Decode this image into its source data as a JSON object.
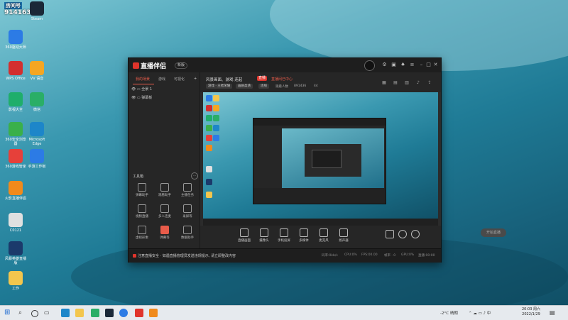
{
  "desktop": {
    "room_overlay": "房间号",
    "room_number": "914163",
    "icons": [
      {
        "label": "3:53",
        "color": "#2a6ad0"
      },
      {
        "label": "Steam",
        "color": "#1b2838"
      },
      {
        "label": "360驱动大师",
        "color": "#2c7be5"
      },
      {
        "label": "WPS Office",
        "color": "#d32f2f"
      },
      {
        "label": "VV 语音",
        "color": "#f5a623"
      },
      {
        "label": "影视大全",
        "color": "#1fae6b"
      },
      {
        "label": "微信",
        "color": "#2aae67"
      },
      {
        "label": "360安全浏览器",
        "color": "#3ab04a"
      },
      {
        "label": "Microsoft Edge",
        "color": "#1d86c9"
      },
      {
        "label": "360游戏管家",
        "color": "#e6403a"
      },
      {
        "label": "手游工作板",
        "color": "#2c7be5"
      },
      {
        "label": "火影直播伴侣",
        "color": "#f08a1c"
      },
      {
        "label": "C0121",
        "color": "#e0e0e0"
      },
      {
        "label": "风暴英雄直播版",
        "color": "#1b3a6b"
      },
      {
        "label": "工作",
        "color": "#f3c64d"
      }
    ]
  },
  "app": {
    "brand": "直播伴侣",
    "version": "新版",
    "left_tabs": [
      "我的场景",
      "游戏",
      "可视化"
    ],
    "scenes": [
      "全景 1",
      "弹幕板"
    ],
    "tools_title": "工具箱",
    "tools": [
      {
        "label": "弹幕助手",
        "red": false
      },
      {
        "label": "观看助手",
        "red": false
      },
      {
        "label": "主播任务",
        "red": false
      },
      {
        "label": "视频直播",
        "red": false
      },
      {
        "label": "多人连麦",
        "red": false
      },
      {
        "label": "录屏等",
        "red": false
      },
      {
        "label": "虚拟形象",
        "red": false
      },
      {
        "label": "弹幕等",
        "red": true
      },
      {
        "label": "数据助手",
        "red": false
      }
    ],
    "room_title": "风景画面、游戏 连起",
    "live_badge": "直播",
    "live_text": "直播间已中心",
    "pills": [
      "游戏 · 王者荣耀",
      "画质高清",
      "连线"
    ],
    "stats": [
      "观看人数",
      "891436",
      "44"
    ],
    "controls": [
      {
        "label": "直播画面"
      },
      {
        "label": "摄像头"
      },
      {
        "label": "手机投屏"
      },
      {
        "label": "多媒体"
      },
      {
        "label": "麦克风"
      },
      {
        "label": "扬声器"
      }
    ],
    "start_live": "开始直播",
    "notice": "注意直播安全 · 如遇直播管理员发送违规提示, 请立即整改内容",
    "status": [
      "码率:0kb/s",
      "CPU:0%",
      "FPS:00.00",
      "帧率 · 0",
      "GPU:0%",
      "直播:00:00"
    ]
  },
  "taskbar": {
    "weather": "-2°C 晴朗",
    "time": "20:03 周六",
    "date": "2022/1/29"
  }
}
